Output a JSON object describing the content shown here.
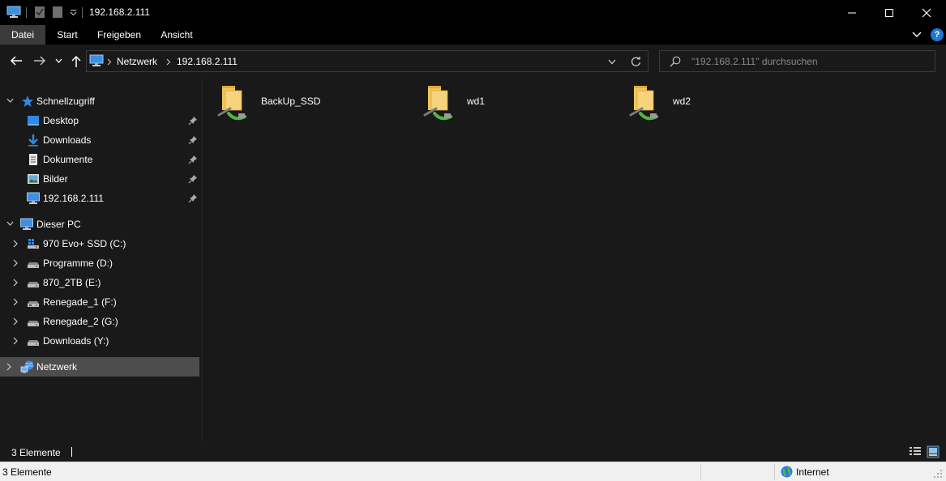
{
  "window": {
    "title": "192.168.2.111"
  },
  "ribbon": {
    "tabs": [
      "Datei",
      "Start",
      "Freigeben",
      "Ansicht"
    ],
    "help": "?"
  },
  "address": {
    "crumbs": [
      "Netzwerk",
      "192.168.2.111"
    ]
  },
  "search": {
    "placeholder": "\"192.168.2.111\" durchsuchen"
  },
  "sidebar": {
    "quick_access": {
      "label": "Schnellzugriff",
      "items": [
        "Desktop",
        "Downloads",
        "Dokumente",
        "Bilder",
        "192.168.2.111"
      ]
    },
    "this_pc": {
      "label": "Dieser PC",
      "drives": [
        "970 Evo+ SSD (C:)",
        "Programme (D:)",
        "870_2TB (E:)",
        "Renegade_1 (F:)",
        "Renegade_2 (G:)",
        "Downloads (Y:)"
      ]
    },
    "network": {
      "label": "Netzwerk"
    }
  },
  "content": {
    "items": [
      "BackUp_SSD",
      "wd1",
      "wd2"
    ]
  },
  "status": {
    "count": "3 Elemente"
  },
  "outer_status": {
    "count": "3 Elemente",
    "zone": "Internet"
  },
  "colors": {
    "selection": "#4d4d4d",
    "accent": "#1e78d6",
    "folder": "#f2c55c"
  }
}
